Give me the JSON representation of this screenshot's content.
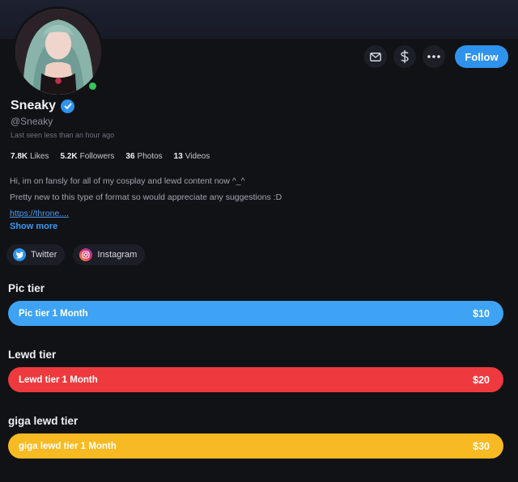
{
  "profile": {
    "display_name": "Sneaky",
    "handle": "@Sneaky",
    "last_seen": "Last seen less than an hour ago",
    "online": true
  },
  "actions": {
    "message_icon": "mail-icon",
    "tip_icon": "dollar-icon",
    "more_icon": "more-dots-icon",
    "follow_label": "Follow"
  },
  "stats": [
    {
      "value": "7.8K",
      "label": "Likes"
    },
    {
      "value": "5.2K",
      "label": "Followers"
    },
    {
      "value": "36",
      "label": "Photos"
    },
    {
      "value": "13",
      "label": "Videos"
    }
  ],
  "bio": {
    "line1": "Hi, im on fansly for all of my cosplay and lewd content now ^_^",
    "line2": "Pretty new to this type of format so would appreciate any suggestions :D",
    "link": "https://throne....",
    "show_more": "Show more"
  },
  "socials": [
    {
      "label": "Twitter",
      "icon": "twitter-icon"
    },
    {
      "label": "Instagram",
      "icon": "instagram-icon"
    }
  ],
  "tiers": [
    {
      "heading": "Pic tier",
      "bar_label": "Pic tier 1 Month",
      "price": "$10",
      "color": "#3ea3f5"
    },
    {
      "heading": "Lewd tier",
      "bar_label": "Lewd tier 1 Month",
      "price": "$20",
      "color": "#ee3a3e"
    },
    {
      "heading": "giga lewd tier",
      "bar_label": "giga lewd tier 1 Month",
      "price": "$30",
      "color": "#f7ba22"
    }
  ],
  "colors": {
    "background": "#111216",
    "accent": "#2f93ee",
    "online": "#35c759"
  }
}
